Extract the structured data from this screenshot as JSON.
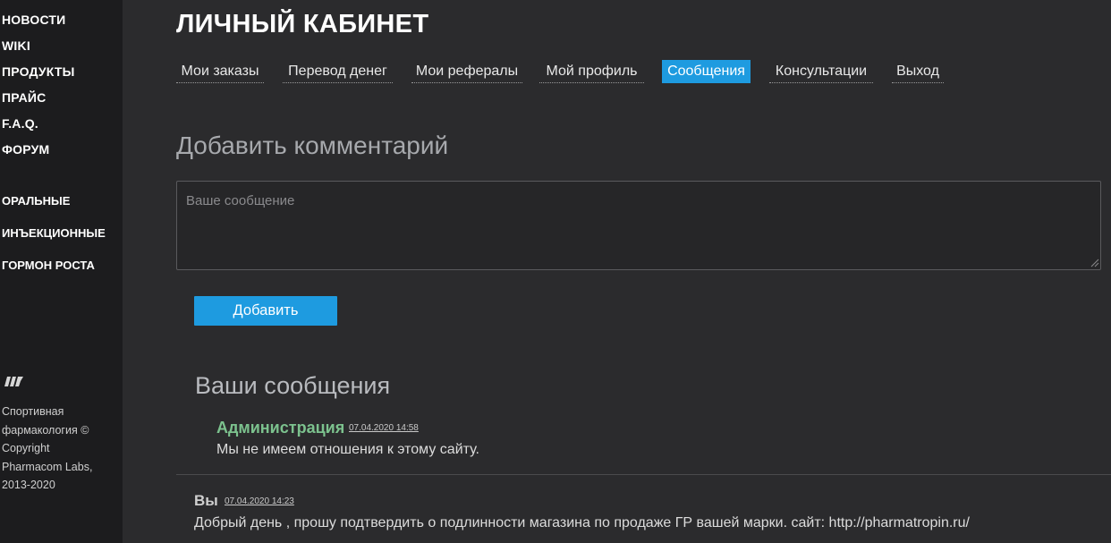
{
  "sidebar": {
    "main_nav": [
      "НОВОСТИ",
      "WIKI",
      "ПРОДУКТЫ",
      "ПРАЙС",
      "F.A.Q.",
      "ФОРУМ"
    ],
    "categories": [
      "ОРАЛЬНЫЕ",
      "ИНЪЕКЦИОННЫЕ",
      "ГОРМОН РОСТА"
    ],
    "logo_icon": "pharmacom-logo-icon",
    "copyright_lines": [
      "Спортивная",
      "фармакология ©",
      "Copyright",
      "Pharmacom Labs,",
      "2013-2020"
    ]
  },
  "header": {
    "title": "ЛИЧНЫЙ КАБИНЕТ"
  },
  "tabs": [
    {
      "label": "Мои заказы",
      "active": false
    },
    {
      "label": "Перевод денег",
      "active": false
    },
    {
      "label": "Мои рефералы",
      "active": false
    },
    {
      "label": "Мой профиль",
      "active": false
    },
    {
      "label": "Сообщения",
      "active": true
    },
    {
      "label": "Консультации",
      "active": false
    },
    {
      "label": "Выход",
      "active": false
    }
  ],
  "comment_form": {
    "title": "Добавить комментарий",
    "placeholder": "Ваше сообщение",
    "value": "",
    "submit_label": "Добавить"
  },
  "messages": {
    "title": "Ваши сообщения",
    "items": [
      {
        "author": "Администрация",
        "date": "07.04.2020 14:58",
        "text": "Мы не имеем отношения к этому сайту."
      },
      {
        "author": "Вы",
        "date": "07.04.2020 14:23",
        "text": "Добрый день , прошу подтвердить о подлинности магазина по продаже ГР вашей марки. сайт: http://pharmatropin.ru/"
      }
    ]
  },
  "colors": {
    "accent": "#1e9be0",
    "background": "#2b2b2d",
    "sidebar_bg": "#1c1c1e",
    "admin_author": "#7cc28e"
  }
}
